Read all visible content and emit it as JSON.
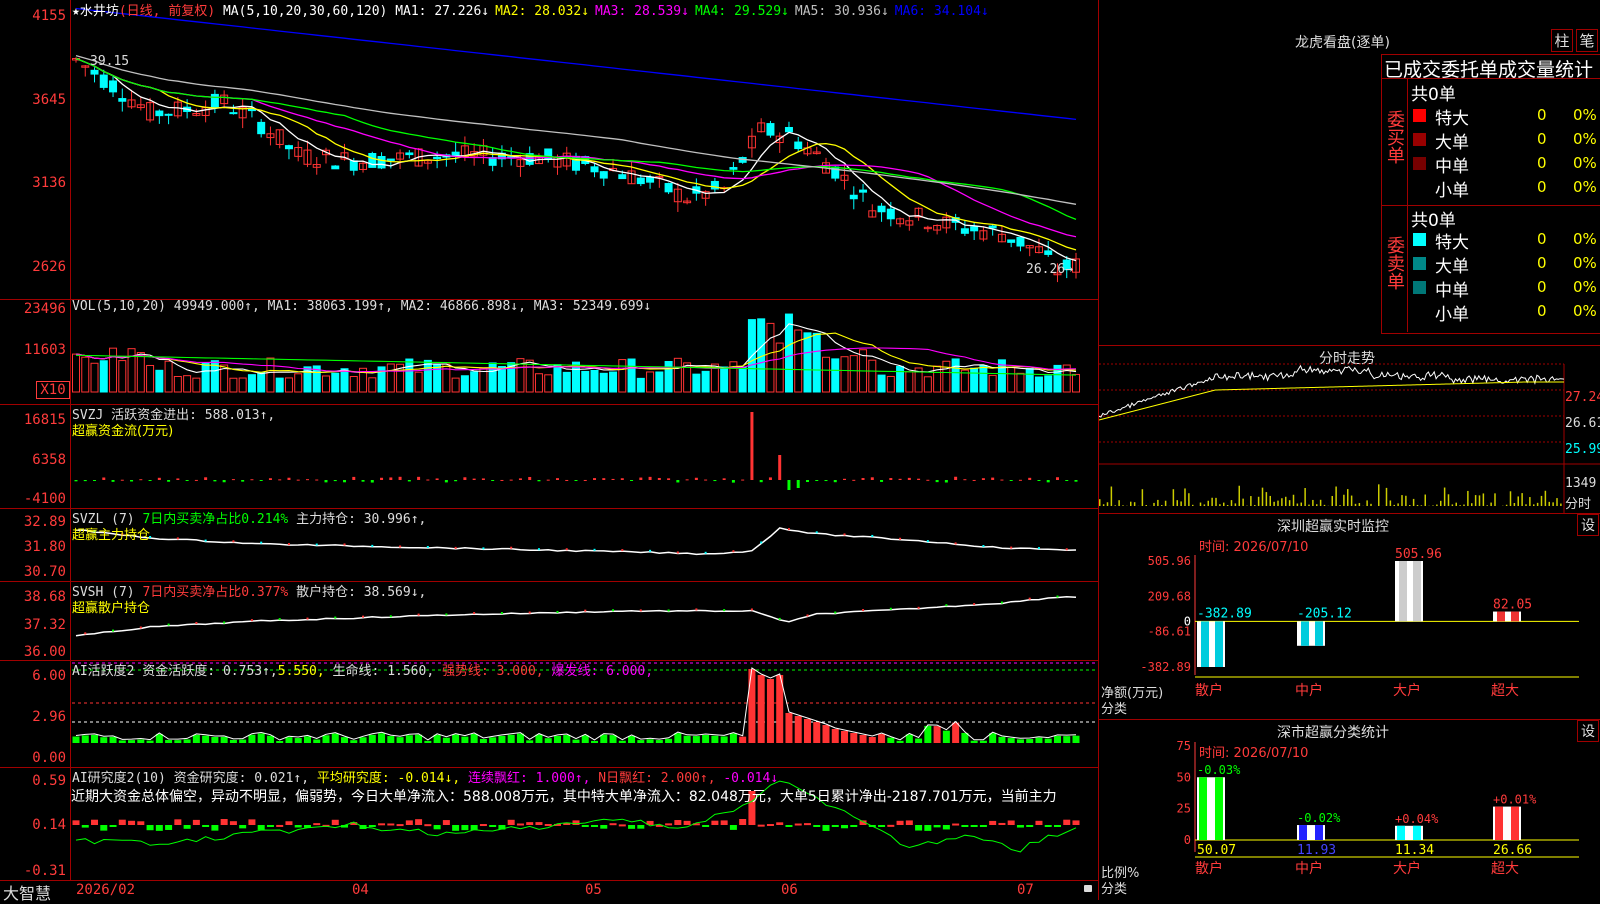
{
  "colors": {
    "up": "#ff3333",
    "down": "#00ffff",
    "grid": "#a00000",
    "yellow": "#ffff00",
    "green": "#00ff00",
    "magenta": "#ff00ff"
  },
  "main": {
    "star": "★",
    "stock_name": "水井坊",
    "period": "(日线, 前复权)",
    "ma_params": "MA(5,10,20,30,60,120)",
    "ma_items": [
      {
        "label": "MA1: 27.226↓",
        "color": "#ffffff"
      },
      {
        "label": "MA2: 28.032↓",
        "color": "#ffff00"
      },
      {
        "label": "MA3: 28.539↓",
        "color": "#ff00ff"
      },
      {
        "label": "MA4: 29.529↓",
        "color": "#00ff00"
      },
      {
        "label": "MA5: 30.936↓",
        "color": "#c0c0c0"
      },
      {
        "label": "MA6: 34.104↓",
        "color": "#0000ff"
      }
    ],
    "y_labels": [
      "4155",
      "3645",
      "3136",
      "2626"
    ],
    "high_note": "39.15",
    "low_note": "26.26→"
  },
  "vol": {
    "title": "VOL(5,10,20) 49949.000↑, MA1: 38063.199↑, MA2: 46866.898↓, MA3: 52349.699↓",
    "y_labels": [
      "23496",
      "11603"
    ],
    "unit": "X10"
  },
  "svzj": {
    "title": "SVZJ  活跃资金进出: 588.013↑,",
    "subtitle": "超赢资金流(万元)",
    "y_labels": [
      "16815",
      "6358",
      "-4100"
    ]
  },
  "svzl": {
    "title_a": "SVZL (7) ",
    "title_b": "7日内买卖净占比0.214%",
    "title_c": " 主力持仓: 30.996↑,",
    "subtitle": "超赢主力持仓",
    "y_labels": [
      "32.89",
      "31.80",
      "30.70"
    ]
  },
  "svsh": {
    "title_a": "SVSH (7) ",
    "title_b": "7日内买卖净占比0.377%",
    "title_c": " 散户持仓: 38.569↓,",
    "subtitle": "超赢散户持仓",
    "y_labels": [
      "38.68",
      "37.32",
      "36.00"
    ]
  },
  "ai2": {
    "t1": "AI活跃度2 资金活跃度: 0.753↑,",
    "t2": "5.550,",
    "t3": " 生命线: 1.560,",
    "t4": " 强势线: 3.000,",
    "t5": " 爆发线: 6.000,",
    "y_labels": [
      "6.00",
      "2.96",
      "0.00"
    ]
  },
  "ai3": {
    "t1": "AI研究度2(10) 资金研究度: 0.021↑,",
    "t2": " 平均研究度: -0.014↓,",
    "t3": " 连续飘红: 1.000↑,",
    "t4": " N日飘红: 2.000↑,",
    "t5": " -0.014↓",
    "summary": "近期大资金总体偏空，异动不明显，偏弱势，今日大单净流入：588.008万元，其中特大单净流入：82.048万元，大单5日累计净出-2187.701万元，当前主力",
    "y_labels": [
      "0.59",
      "0.14",
      "-0.31"
    ]
  },
  "bottom": {
    "app": "大智慧",
    "dates": [
      "2026/02",
      "04",
      "05",
      "06",
      "07"
    ]
  },
  "dragon": {
    "title": "龙虎看盘(逐单)",
    "btn1": "柱",
    "btn2": "笔",
    "stat_title": "已成交委托单成交量统计",
    "buy_label": "委买单",
    "sell_label": "委卖单",
    "buy_total": "共0单",
    "sell_total": "共0单",
    "buy_rows": [
      {
        "name": "特大",
        "val": "0",
        "pct": "0%",
        "color": "#ff0000"
      },
      {
        "name": "大单",
        "val": "0",
        "pct": "0%",
        "color": "#990000"
      },
      {
        "name": "中单",
        "val": "0",
        "pct": "0%",
        "color": "#770000"
      },
      {
        "name": "小单",
        "val": "0",
        "pct": "0%",
        "color": ""
      }
    ],
    "sell_rows": [
      {
        "name": "特大",
        "val": "0",
        "pct": "0%",
        "color": "#00ffff"
      },
      {
        "name": "大单",
        "val": "0",
        "pct": "0%",
        "color": "#008888"
      },
      {
        "name": "中单",
        "val": "0",
        "pct": "0%",
        "color": "#007777"
      },
      {
        "name": "小单",
        "val": "0",
        "pct": "0%",
        "color": ""
      }
    ]
  },
  "intraday": {
    "title": "分时走势",
    "y_labels": [
      "27.24",
      "26.61",
      "25.99"
    ],
    "vol_label": "1349",
    "vol_unit": "分时"
  },
  "monitor": {
    "title": "深圳超赢实时监控",
    "settings": "设",
    "time": "时间: 2026/07/10",
    "y_labels": [
      "505.96",
      "209.68",
      "0",
      "-86.61",
      "-382.89"
    ],
    "ylabel": "净额(万元)",
    "xlabel": "分类",
    "categories": [
      "散户",
      "中户",
      "大户",
      "超大"
    ],
    "values": [
      -382.89,
      -205.12,
      505.96,
      82.05
    ],
    "value_labels": [
      "-382.89",
      "-205.12",
      "505.96",
      "82.05"
    ]
  },
  "classify": {
    "title": "深市超赢分类统计",
    "settings": "设",
    "time": "时间: 2026/07/10",
    "y_labels": [
      "75",
      "50",
      "25",
      "0"
    ],
    "ylabel": "比例%",
    "xlabel": "分类",
    "categories": [
      "散户",
      "中户",
      "大户",
      "超大"
    ],
    "values": [
      50.07,
      11.93,
      11.34,
      26.66
    ],
    "value_labels": [
      "50.07",
      "11.93",
      "11.34",
      "26.66"
    ],
    "changes": [
      "-0.03%",
      "-0.02%",
      "+0.04%",
      "+0.01%"
    ]
  }
}
